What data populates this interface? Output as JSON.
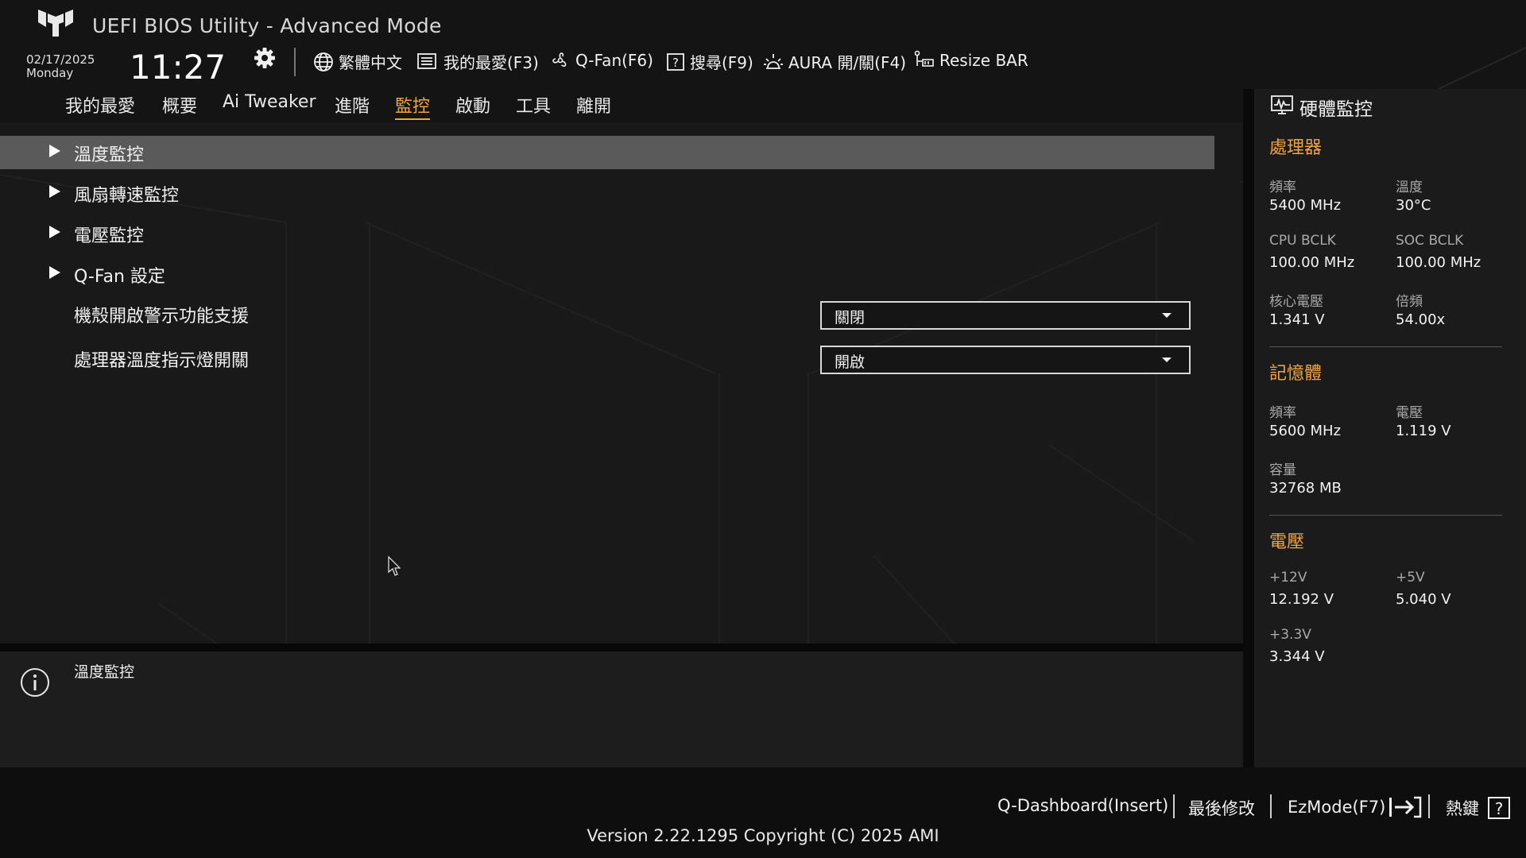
{
  "header": {
    "title": "UEFI BIOS Utility - Advanced Mode",
    "date": "02/17/2025",
    "weekday": "Monday",
    "time": "11:27"
  },
  "toolbar": {
    "language": "繁體中文",
    "favorites": "我的最愛(F3)",
    "qfan": "Q-Fan(F6)",
    "search": "搜尋(F9)",
    "aura": "AURA 開/關(F4)",
    "resize_bar": "Resize BAR"
  },
  "menu": {
    "items": [
      "我的最愛",
      "概要",
      "Ai Tweaker",
      "進階",
      "監控",
      "啟動",
      "工具",
      "離開"
    ],
    "active_index": 4
  },
  "main": {
    "submenus": [
      "溫度監控",
      "風扇轉速監控",
      "電壓監控",
      "Q-Fan 設定"
    ],
    "selected_index": 0,
    "settings": [
      {
        "label": "機殼開啟警示功能支援",
        "value": "關閉"
      },
      {
        "label": "處理器溫度指示燈開關",
        "value": "開啟"
      }
    ]
  },
  "info": {
    "text": "溫度監控"
  },
  "hw_monitor": {
    "title": "硬體監控",
    "cpu": {
      "heading": "處理器",
      "freq_label": "頻率",
      "freq_value": "5400 MHz",
      "temp_label": "溫度",
      "temp_value": "30°C",
      "bclk_label": "CPU BCLK",
      "bclk_value": "100.00 MHz",
      "soc_label": "SOC BCLK",
      "soc_value": "100.00 MHz",
      "vcore_label": "核心電壓",
      "vcore_value": "1.341 V",
      "ratio_label": "倍頻",
      "ratio_value": "54.00x"
    },
    "memory": {
      "heading": "記憶體",
      "freq_label": "頻率",
      "freq_value": "5600 MHz",
      "volt_label": "電壓",
      "volt_value": "1.119 V",
      "cap_label": "容量",
      "cap_value": "32768 MB"
    },
    "voltage": {
      "heading": "電壓",
      "v12_label": "+12V",
      "v12_value": "12.192 V",
      "v5_label": "+5V",
      "v5_value": "5.040 V",
      "v33_label": "+3.3V",
      "v33_value": "3.344 V"
    }
  },
  "footer": {
    "qdashboard": "Q-Dashboard(Insert)",
    "last_modified": "最後修改",
    "ezmode": "EzMode(F7)",
    "hotkeys": "熱鍵",
    "version": "Version 2.22.1295 Copyright (C) 2025 AMI"
  },
  "colors": {
    "accent": "#f0a43a",
    "background": "#141414",
    "selected_row": "#5a5a5a"
  },
  "icons": [
    "tuf-logo-icon",
    "gear-icon",
    "globe-icon",
    "favorites-list-icon",
    "fan-icon",
    "help-box-icon",
    "aura-light-icon",
    "resize-bar-icon",
    "info-icon",
    "hw-monitor-icon",
    "ezmode-exit-icon",
    "help-icon",
    "mouse-cursor-icon"
  ]
}
